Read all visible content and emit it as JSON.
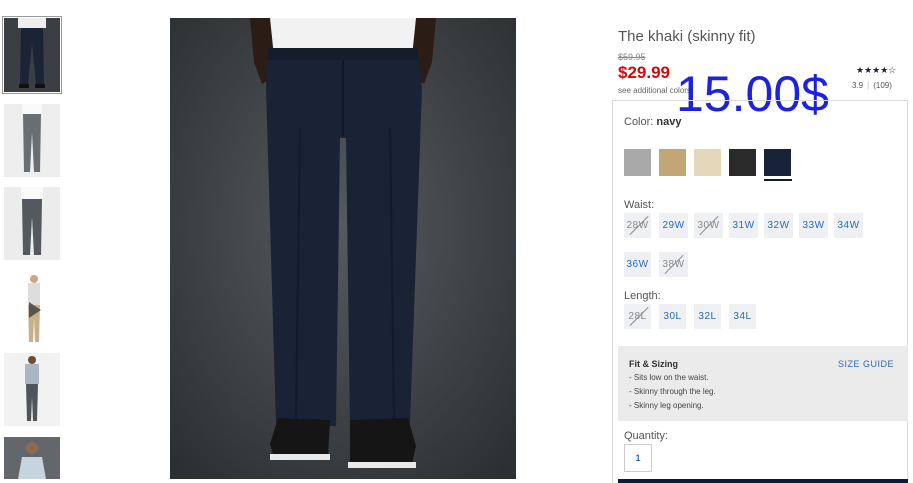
{
  "product": {
    "title": "The khaki (skinny fit)",
    "original_price": "$59.95",
    "sale_price": "$29.99",
    "see_colors": "see additional colors",
    "overlay_price": "15.00$",
    "stars": "★★★★☆",
    "rating_value": "3.9",
    "review_count": "(109)"
  },
  "thumbnails": [
    {
      "label": "front-navy",
      "selected": true
    },
    {
      "label": "grey-side"
    },
    {
      "label": "grey-front"
    },
    {
      "label": "video-khaki",
      "video": true
    },
    {
      "label": "full-body-grey"
    },
    {
      "label": "top-shirt"
    }
  ],
  "color": {
    "label": "Color:",
    "selected": "navy",
    "swatches": [
      {
        "name": "grey",
        "hex": "#a9a9a9"
      },
      {
        "name": "khaki",
        "hex": "#c3a676"
      },
      {
        "name": "stone",
        "hex": "#e4d7ba"
      },
      {
        "name": "black",
        "hex": "#2a2a2a"
      },
      {
        "name": "navy",
        "hex": "#172338"
      }
    ]
  },
  "waist": {
    "label": "Waist:",
    "sizes": [
      {
        "label": "28W",
        "available": false
      },
      {
        "label": "29W",
        "available": true
      },
      {
        "label": "30W",
        "available": false
      },
      {
        "label": "31W",
        "available": true
      },
      {
        "label": "32W",
        "available": true
      },
      {
        "label": "33W",
        "available": true
      },
      {
        "label": "34W",
        "available": true
      },
      {
        "label": "36W",
        "available": true
      },
      {
        "label": "38W",
        "available": false
      }
    ]
  },
  "length": {
    "label": "Length:",
    "sizes": [
      {
        "label": "28L",
        "available": false
      },
      {
        "label": "30L",
        "available": true
      },
      {
        "label": "32L",
        "available": true
      },
      {
        "label": "34L",
        "available": true
      }
    ]
  },
  "fit": {
    "title": "Fit & Sizing",
    "size_guide": "SIZE GUIDE",
    "lines": [
      "- Sits low on the waist.",
      "- Skinny through the leg.",
      "- Skinny leg opening."
    ]
  },
  "quantity": {
    "label": "Quantity:",
    "value": "1"
  }
}
